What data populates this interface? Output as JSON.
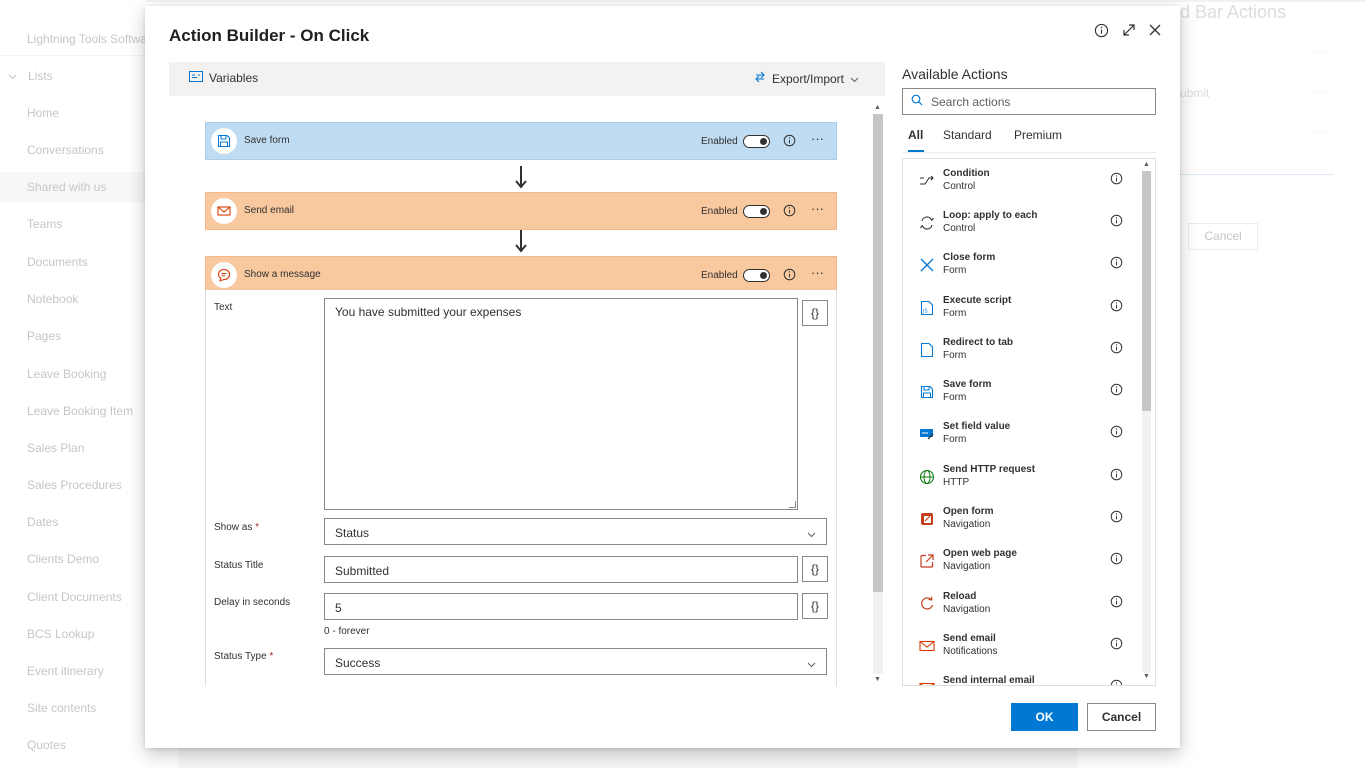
{
  "background": {
    "site_name": "Lightning Tools Softwa",
    "lists_label": "Lists",
    "nav_items": [
      "Home",
      "Conversations",
      "Shared with us",
      "Teams",
      "Documents",
      "Notebook",
      "Pages",
      "Leave Booking",
      "Leave Booking Item",
      "Sales Plan",
      "Sales Procedures",
      "Dates",
      "Clients Demo",
      "Client Documents",
      "BCS Lookup",
      "Event itinerary",
      "Site contents",
      "Quotes"
    ],
    "right_title": "d Bar Actions",
    "right_text": "ubmit",
    "cancel_label": "Cancel"
  },
  "dialog": {
    "title": "Action Builder - On Click",
    "toolbar": {
      "variables_label": "Variables",
      "export_label": "Export/Import"
    },
    "actions": [
      {
        "label": "Save form",
        "enabled_label": "Enabled",
        "enabled": true,
        "color": "#bfdcf3"
      },
      {
        "label": "Send email",
        "enabled_label": "Enabled",
        "enabled": true,
        "color": "#f8c89f"
      },
      {
        "label": "Show a message",
        "enabled_label": "Enabled",
        "enabled": true,
        "color": "#f8c89f"
      }
    ],
    "show_message": {
      "text_label": "Text",
      "text_value": "You have submitted your expenses",
      "show_as_label": "Show as",
      "show_as_value": "Status",
      "status_title_label": "Status Title",
      "status_title_value": "Submitted",
      "delay_label": "Delay in seconds",
      "delay_value": "5",
      "delay_helper": "0 - forever",
      "status_type_label": "Status Type",
      "status_type_value": "Success",
      "required_mark": "*",
      "brace": "{}"
    },
    "available": {
      "title": "Available Actions",
      "search_placeholder": "Search actions",
      "tabs": [
        "All",
        "Standard",
        "Premium"
      ],
      "active_tab": "All",
      "items": [
        {
          "name": "Condition",
          "category": "Control",
          "icon": "condition-icon"
        },
        {
          "name": "Loop: apply to each",
          "category": "Control",
          "icon": "loop-icon"
        },
        {
          "name": "Close form",
          "category": "Form",
          "icon": "close-form-icon"
        },
        {
          "name": "Execute script",
          "category": "Form",
          "icon": "script-icon"
        },
        {
          "name": "Redirect to tab",
          "category": "Form",
          "icon": "tab-icon"
        },
        {
          "name": "Save form",
          "category": "Form",
          "icon": "save-icon"
        },
        {
          "name": "Set field value",
          "category": "Form",
          "icon": "field-value-icon"
        },
        {
          "name": "Send HTTP request",
          "category": "HTTP",
          "icon": "globe-icon"
        },
        {
          "name": "Open form",
          "category": "Navigation",
          "icon": "open-form-icon"
        },
        {
          "name": "Open web page",
          "category": "Navigation",
          "icon": "open-web-icon"
        },
        {
          "name": "Reload",
          "category": "Navigation",
          "icon": "reload-icon"
        },
        {
          "name": "Send email",
          "category": "Notifications",
          "icon": "email-icon"
        },
        {
          "name": "Send internal email",
          "category": "",
          "icon": "email-icon"
        }
      ]
    },
    "ok_label": "OK",
    "cancel_label": "Cancel"
  },
  "colors": {
    "accent": "#0078d4",
    "save_card": "#bfdcf3",
    "email_card": "#f8c89f"
  }
}
